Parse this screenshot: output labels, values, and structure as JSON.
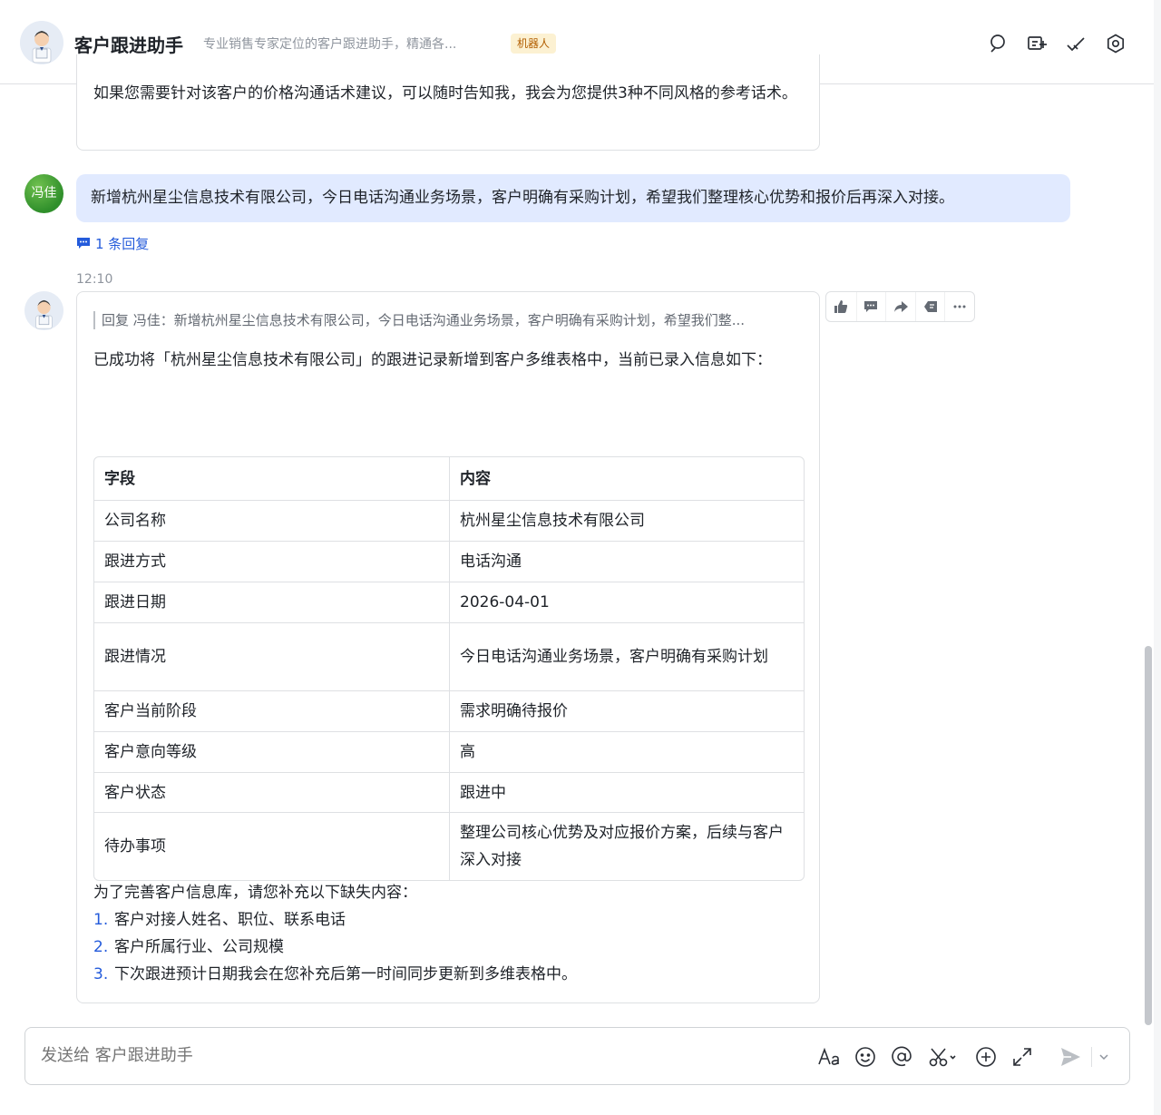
{
  "header": {
    "title": "客户跟进助手",
    "description": "专业销售专家定位的客户跟进助手，精通各...",
    "badge": "机器人"
  },
  "previous_message": {
    "text": "如果您需要针对该客户的价格沟通话术建议，可以随时告知我，我会为您提供3种不同风格的参考话术。"
  },
  "user_message": {
    "avatar_text": "冯佳",
    "text": "新增杭州星尘信息技术有限公司，今日电话沟通业务场景，客户明确有采购计划，希望我们整理核心优势和报价后再深入对接。",
    "reply_count": "1 条回复"
  },
  "bot_message": {
    "timestamp": "12:10",
    "quote": "回复 冯佳：新增杭州星尘信息技术有限公司，今日电话沟通业务场景，客户明确有采购计划，希望我们整...",
    "intro": "已成功将「杭州星尘信息技术有限公司」的跟进记录新增到客户多维表格中，当前已录入信息如下：",
    "table": {
      "headers": [
        "字段",
        "内容"
      ],
      "rows": [
        [
          "公司名称",
          "杭州星尘信息技术有限公司"
        ],
        [
          "跟进方式",
          "电话沟通"
        ],
        [
          "跟进日期",
          "2026-04-01"
        ],
        [
          "跟进情况",
          "今日电话沟通业务场景，客户明确有采购计划"
        ],
        [
          "客户当前阶段",
          "需求明确待报价"
        ],
        [
          "客户意向等级",
          "高"
        ],
        [
          "客户状态",
          "跟进中"
        ],
        [
          "待办事项",
          "整理公司核心优势及对应报价方案，后续与客户深入对接"
        ]
      ]
    },
    "followup_intro": "为了完善客户信息库，请您补充以下缺失内容：",
    "followup_items": [
      {
        "num": "1.",
        "text": "客户对接人姓名、职位、联系电话"
      },
      {
        "num": "2.",
        "text": "客户所属行业、公司规模"
      },
      {
        "num": "3.",
        "text": "下次跟进预计日期我会在您补充后第一时间同步更新到多维表格中。"
      }
    ]
  },
  "input": {
    "placeholder": "发送给 客户跟进助手"
  },
  "colors": {
    "accent": "#245bdb",
    "user_bubble": "#e1eaff",
    "badge_bg": "#fcf1d2",
    "badge_text": "#b25e00"
  }
}
